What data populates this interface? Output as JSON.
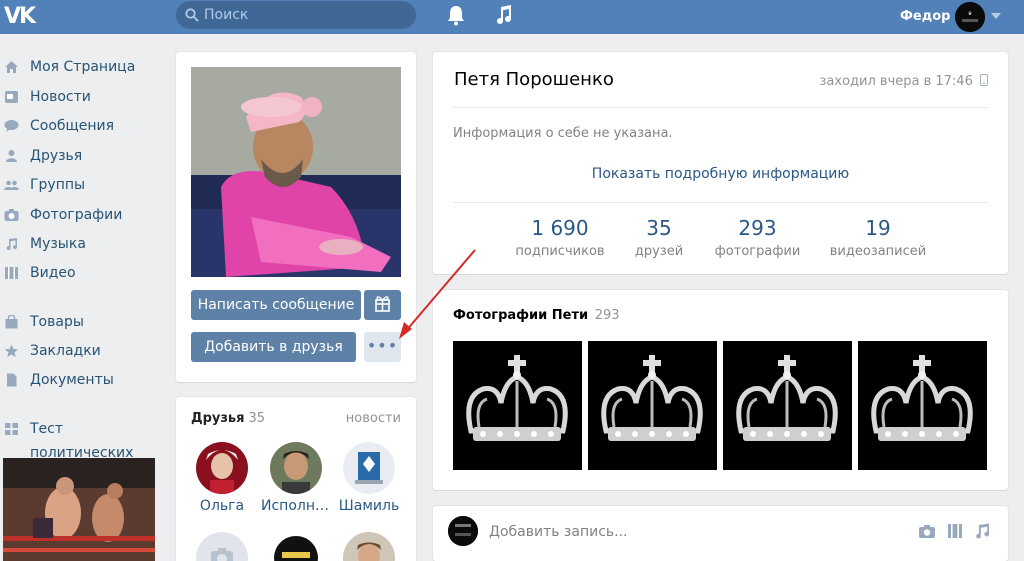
{
  "topbar": {
    "logo": "VK",
    "search_placeholder": "Поиск",
    "username": "Федор"
  },
  "nav": {
    "items": [
      {
        "label": "Моя Страница",
        "icon": "home-icon"
      },
      {
        "label": "Новости",
        "icon": "news-icon"
      },
      {
        "label": "Сообщения",
        "icon": "messages-icon"
      },
      {
        "label": "Друзья",
        "icon": "friends-icon"
      },
      {
        "label": "Группы",
        "icon": "groups-icon"
      },
      {
        "label": "Фотографии",
        "icon": "camera-icon"
      },
      {
        "label": "Музыка",
        "icon": "music-icon"
      },
      {
        "label": "Видео",
        "icon": "video-icon"
      },
      {
        "label": "Товары",
        "icon": "bag-icon"
      },
      {
        "label": "Закладки",
        "icon": "star-icon"
      },
      {
        "label": "Документы",
        "icon": "document-icon"
      },
      {
        "label": "Тест политических",
        "icon": "apps-icon"
      }
    ]
  },
  "profile": {
    "write_message": "Написать сообщение",
    "add_friend": "Добавить в друзья",
    "more": "•••"
  },
  "friends": {
    "title": "Друзья",
    "count": "35",
    "news_link": "новости",
    "people": [
      {
        "name": "Ольга"
      },
      {
        "name": "Исполнит…"
      },
      {
        "name": "Шамиль"
      }
    ]
  },
  "info": {
    "name": "Петя Порошенко",
    "last_seen": "заходил вчера в 17:46",
    "about": "Информация о себе не указана.",
    "show_more": "Показать подробную информацию",
    "stats": [
      {
        "num": "1 690",
        "label": "подписчиков"
      },
      {
        "num": "35",
        "label": "друзей"
      },
      {
        "num": "293",
        "label": "фотографии"
      },
      {
        "num": "19",
        "label": "видеозаписей"
      }
    ]
  },
  "photos": {
    "title": "Фотографии Пети",
    "count": "293"
  },
  "post": {
    "placeholder": "Добавить запись..."
  },
  "colors": {
    "brand": "#5181b8",
    "link": "#2a5885",
    "button": "#5e81a8",
    "annotation_arrow": "#d42a2a"
  }
}
